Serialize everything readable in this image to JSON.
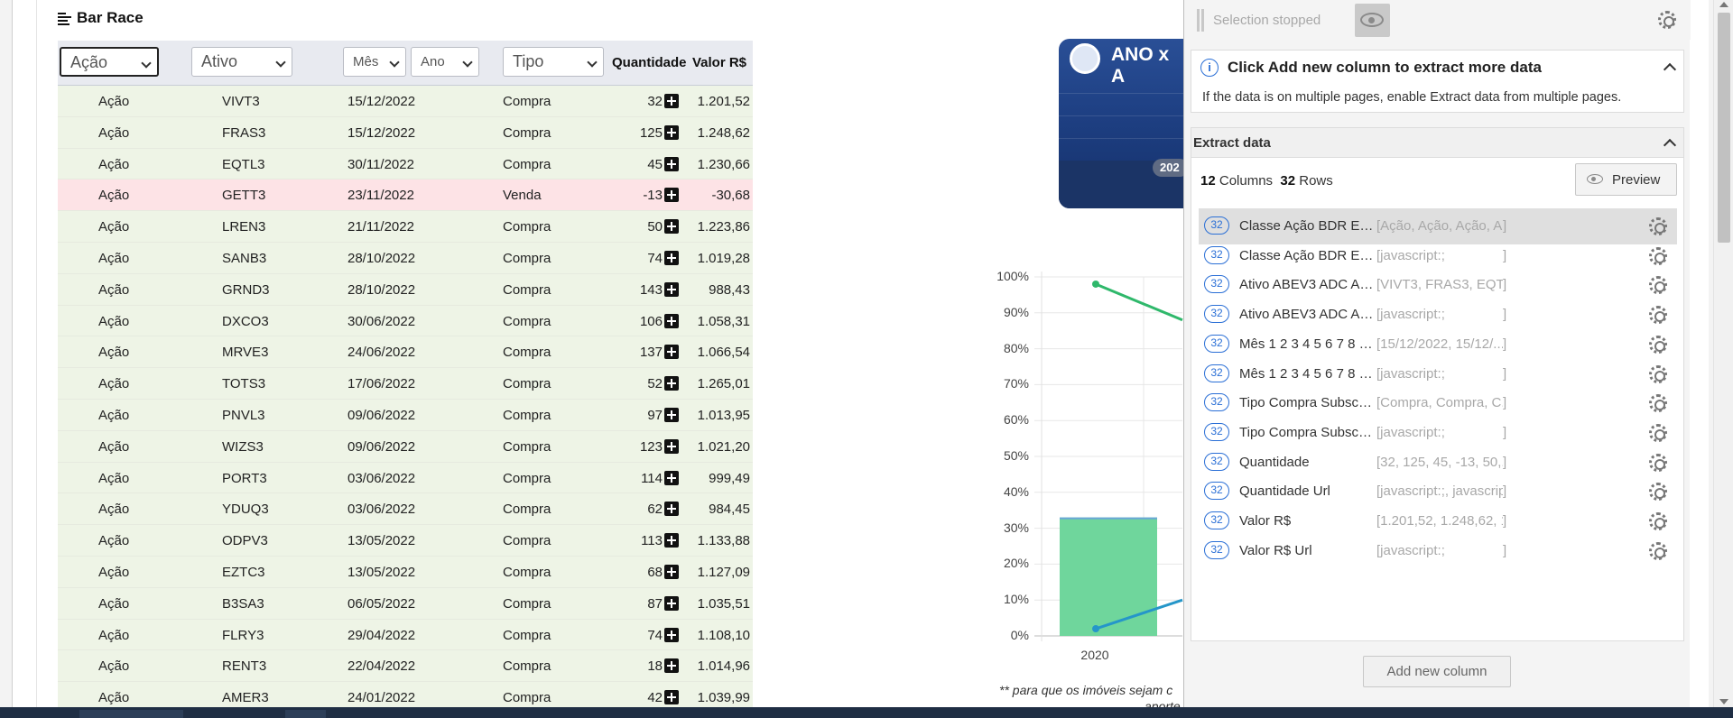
{
  "page": {
    "title": "Bar Race"
  },
  "table": {
    "filters": {
      "classe_placeholder": "Ação",
      "ativo_placeholder": "Ativo",
      "mes_placeholder": "Mês",
      "ano_placeholder": "Ano",
      "tipo_placeholder": "Tipo"
    },
    "headers": {
      "quantidade": "Quantidade",
      "valor": "Valor R$"
    },
    "rows": [
      {
        "classe": "Ação",
        "ativo": "VIVT3",
        "data": "15/12/2022",
        "tipo": "Compra",
        "quantidade": "32",
        "valor": "1.201,52"
      },
      {
        "classe": "Ação",
        "ativo": "FRAS3",
        "data": "15/12/2022",
        "tipo": "Compra",
        "quantidade": "125",
        "valor": "1.248,62"
      },
      {
        "classe": "Ação",
        "ativo": "EQTL3",
        "data": "30/11/2022",
        "tipo": "Compra",
        "quantidade": "45",
        "valor": "1.230,66"
      },
      {
        "classe": "Ação",
        "ativo": "GETT3",
        "data": "23/11/2022",
        "tipo": "Venda",
        "quantidade": "-13",
        "valor": "-30,68"
      },
      {
        "classe": "Ação",
        "ativo": "LREN3",
        "data": "21/11/2022",
        "tipo": "Compra",
        "quantidade": "50",
        "valor": "1.223,86"
      },
      {
        "classe": "Ação",
        "ativo": "SANB3",
        "data": "28/10/2022",
        "tipo": "Compra",
        "quantidade": "74",
        "valor": "1.019,28"
      },
      {
        "classe": "Ação",
        "ativo": "GRND3",
        "data": "28/10/2022",
        "tipo": "Compra",
        "quantidade": "143",
        "valor": "988,43"
      },
      {
        "classe": "Ação",
        "ativo": "DXCO3",
        "data": "30/06/2022",
        "tipo": "Compra",
        "quantidade": "106",
        "valor": "1.058,31"
      },
      {
        "classe": "Ação",
        "ativo": "MRVE3",
        "data": "24/06/2022",
        "tipo": "Compra",
        "quantidade": "137",
        "valor": "1.066,54"
      },
      {
        "classe": "Ação",
        "ativo": "TOTS3",
        "data": "17/06/2022",
        "tipo": "Compra",
        "quantidade": "52",
        "valor": "1.265,01"
      },
      {
        "classe": "Ação",
        "ativo": "PNVL3",
        "data": "09/06/2022",
        "tipo": "Compra",
        "quantidade": "97",
        "valor": "1.013,95"
      },
      {
        "classe": "Ação",
        "ativo": "WIZS3",
        "data": "09/06/2022",
        "tipo": "Compra",
        "quantidade": "123",
        "valor": "1.021,20"
      },
      {
        "classe": "Ação",
        "ativo": "PORT3",
        "data": "03/06/2022",
        "tipo": "Compra",
        "quantidade": "114",
        "valor": "999,49"
      },
      {
        "classe": "Ação",
        "ativo": "YDUQ3",
        "data": "03/06/2022",
        "tipo": "Compra",
        "quantidade": "62",
        "valor": "984,45"
      },
      {
        "classe": "Ação",
        "ativo": "ODPV3",
        "data": "13/05/2022",
        "tipo": "Compra",
        "quantidade": "113",
        "valor": "1.133,88"
      },
      {
        "classe": "Ação",
        "ativo": "EZTC3",
        "data": "13/05/2022",
        "tipo": "Compra",
        "quantidade": "68",
        "valor": "1.127,09"
      },
      {
        "classe": "Ação",
        "ativo": "B3SA3",
        "data": "06/05/2022",
        "tipo": "Compra",
        "quantidade": "87",
        "valor": "1.035,51"
      },
      {
        "classe": "Ação",
        "ativo": "FLRY3",
        "data": "29/04/2022",
        "tipo": "Compra",
        "quantidade": "74",
        "valor": "1.108,10"
      },
      {
        "classe": "Ação",
        "ativo": "RENT3",
        "data": "22/04/2022",
        "tipo": "Compra",
        "quantidade": "18",
        "valor": "1.014,96"
      },
      {
        "classe": "Ação",
        "ativo": "AMER3",
        "data": "24/01/2022",
        "tipo": "Compra",
        "quantidade": "42",
        "valor": "1.039,99"
      }
    ]
  },
  "banner": {
    "title": "ANO x A",
    "year_pill": "202"
  },
  "chart_data": {
    "type": "bar",
    "categories": [
      "2020"
    ],
    "yticks": [
      "100%",
      "90%",
      "80%",
      "70%",
      "60%",
      "50%",
      "40%",
      "30%",
      "20%",
      "10%",
      "0%"
    ],
    "ylim": [
      0,
      100
    ],
    "bar_values": [
      33
    ],
    "line_green": [
      98
    ],
    "line_blue": [
      2
    ],
    "colors": {
      "bar": "#6fd69c",
      "line_green": "#2fb86b",
      "line_blue": "#2596c9"
    }
  },
  "footnote": {
    "line1": "** para que os imóveis sejam c",
    "line2": "aporte"
  },
  "panel": {
    "status": "Selection stopped",
    "info_title": "Click Add new column to extract more data",
    "info_sub": "If the data is on multiple pages, enable Extract data from multiple pages.",
    "extract_title": "Extract data",
    "columns_count": "12",
    "columns_label": "Columns",
    "rows_count": "32",
    "rows_label": "Rows",
    "preview_label": "Preview",
    "columns": [
      {
        "count": "32",
        "name": "Classe Ação BDR ETF...",
        "preview": "[Ação, Ação, Ação, A...",
        "close": "]"
      },
      {
        "count": "32",
        "name": "Classe Ação BDR ETF...",
        "preview": "[javascript:;",
        "close": "]"
      },
      {
        "count": "32",
        "name": "Ativo ABEV3 ADC AE...",
        "preview": "[VIVT3, FRAS3, EQTL...",
        "close": "]"
      },
      {
        "count": "32",
        "name": "Ativo ABEV3 ADC AE...",
        "preview": "[javascript:;",
        "close": "]"
      },
      {
        "count": "32",
        "name": "Mês 1 2 3 4 5 6 7 8 9...",
        "preview": "[15/12/2022, 15/12/...",
        "close": "]"
      },
      {
        "count": "32",
        "name": "Mês 1 2 3 4 5 6 7 8 9...",
        "preview": "[javascript:;",
        "close": "]"
      },
      {
        "count": "32",
        "name": "Tipo Compra Subscri...",
        "preview": "[Compra, Compra, C...",
        "close": "]"
      },
      {
        "count": "32",
        "name": "Tipo Compra Subscri...",
        "preview": "[javascript:;",
        "close": "]"
      },
      {
        "count": "32",
        "name": "Quantidade",
        "preview": "[32, 125, 45, -13, 50,...",
        "close": "]"
      },
      {
        "count": "32",
        "name": "Quantidade Url",
        "preview": "[javascript:;, javascrip...",
        "close": "]"
      },
      {
        "count": "32",
        "name": "Valor R$",
        "preview": "[1.201,52, 1.248,62, 1...",
        "close": "]"
      },
      {
        "count": "32",
        "name": "Valor R$ Url",
        "preview": "[javascript:;",
        "close": "]"
      }
    ],
    "add_column": "Add new column"
  }
}
